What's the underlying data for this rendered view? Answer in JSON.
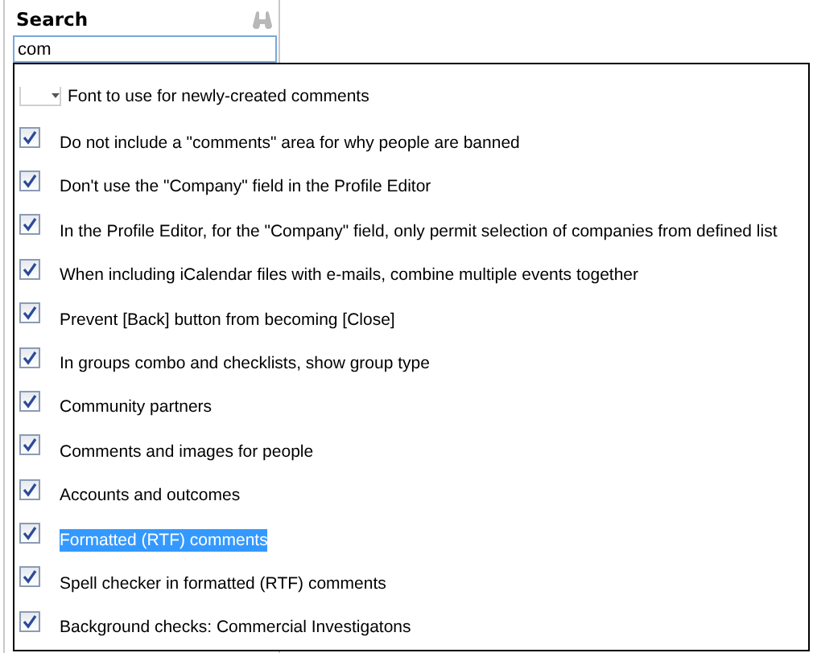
{
  "search": {
    "label": "Search",
    "value": "com"
  },
  "options": [
    {
      "kind": "dropdown",
      "label": "Font to use for newly-created comments",
      "selected": false
    },
    {
      "kind": "checkbox",
      "label": "Do not include a \"comments\" area for why people are banned",
      "checked": true,
      "selected": false
    },
    {
      "kind": "checkbox",
      "label": "Don't use the \"Company\" field in the Profile Editor",
      "checked": true,
      "selected": false
    },
    {
      "kind": "checkbox",
      "label": "In the Profile Editor, for the \"Company\" field, only permit selection of companies from defined list",
      "checked": true,
      "selected": false
    },
    {
      "kind": "checkbox",
      "label": "When including iCalendar files with e-mails, combine multiple events together",
      "checked": true,
      "selected": false
    },
    {
      "kind": "checkbox",
      "label": "Prevent [Back] button from becoming [Close]",
      "checked": true,
      "selected": false
    },
    {
      "kind": "checkbox",
      "label": "In groups combo and checklists, show group type",
      "checked": true,
      "selected": false
    },
    {
      "kind": "checkbox",
      "label": "Community partners",
      "checked": true,
      "selected": false
    },
    {
      "kind": "checkbox",
      "label": "Comments and images for people",
      "checked": true,
      "selected": false
    },
    {
      "kind": "checkbox",
      "label": "Accounts and outcomes",
      "checked": true,
      "selected": false
    },
    {
      "kind": "checkbox",
      "label": "Formatted (RTF) comments",
      "checked": true,
      "selected": true
    },
    {
      "kind": "checkbox",
      "label": "Spell checker in formatted (RTF) comments",
      "checked": true,
      "selected": false
    },
    {
      "kind": "checkbox",
      "label": "Background checks: Commercial Investigatons",
      "checked": true,
      "selected": false
    }
  ]
}
